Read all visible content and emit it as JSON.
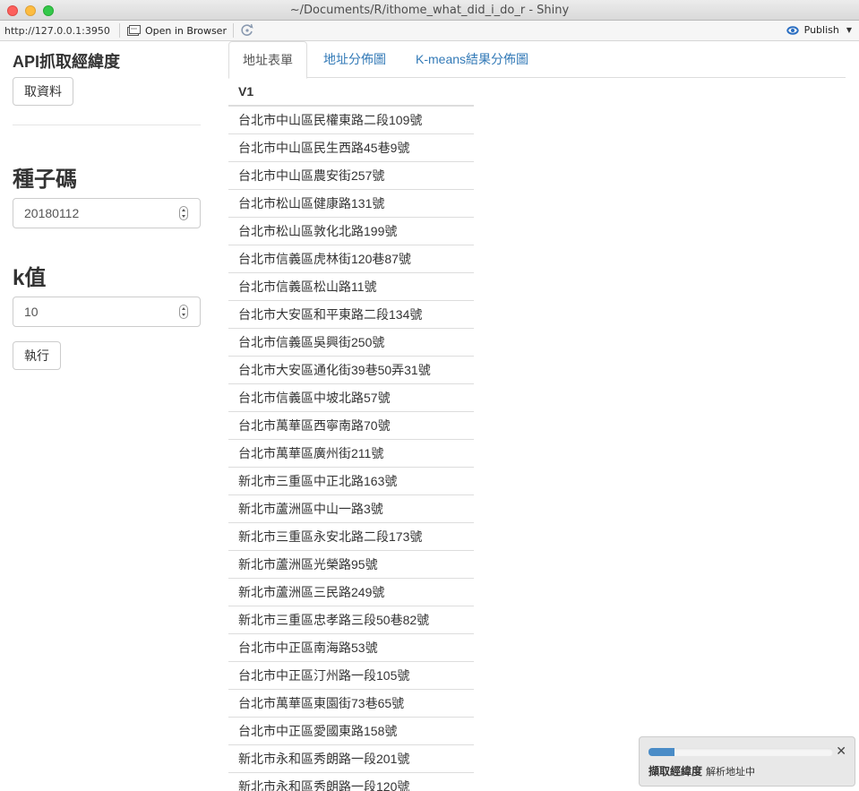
{
  "window": {
    "title": "~/Documents/R/ithome_what_did_i_do_r - Shiny"
  },
  "toolbar": {
    "url": "http://127.0.0.1:3950",
    "open_browser_label": "Open in Browser",
    "publish_label": "Publish",
    "accent": "#2a6ec2"
  },
  "sidebar": {
    "api_title": "API抓取經緯度",
    "fetch_button": "取資料",
    "seed_label": "種子碼",
    "seed_value": "20180112",
    "k_label": "k值",
    "k_value": "10",
    "run_button": "執行"
  },
  "tabs": [
    {
      "label": "地址表單",
      "active": true
    },
    {
      "label": "地址分佈圖",
      "active": false
    },
    {
      "label": "K-means結果分佈圖",
      "active": false
    }
  ],
  "table": {
    "header": "V1",
    "rows": [
      "台北市中山區民權東路二段109號",
      "台北市中山區民生西路45巷9號",
      "台北市中山區農安街257號",
      "台北市松山區健康路131號",
      "台北市松山區敦化北路199號",
      "台北市信義區虎林街120巷87號",
      "台北市信義區松山路11號",
      "台北市大安區和平東路二段134號",
      "台北市信義區吳興街250號",
      "台北市大安區通化街39巷50弄31號",
      "台北市信義區中坡北路57號",
      "台北市萬華區西寧南路70號",
      "台北市萬華區廣州街211號",
      "新北市三重區中正北路163號",
      "新北市蘆洲區中山一路3號",
      "新北市三重區永安北路二段173號",
      "新北市蘆洲區光榮路95號",
      "新北市蘆洲區三民路249號",
      "新北市三重區忠孝路三段50巷82號",
      "台北市中正區南海路53號",
      "台北市中正區汀州路一段105號",
      "台北市萬華區東園街73巷65號",
      "台北市中正區愛國東路158號",
      "新北市永和區秀朗路一段201號",
      "新北市永和區秀朗路一段120號"
    ]
  },
  "notification": {
    "title": "擷取經緯度",
    "detail": "解析地址中",
    "progress": 0.14,
    "bar_color": "#4a8cc7"
  }
}
